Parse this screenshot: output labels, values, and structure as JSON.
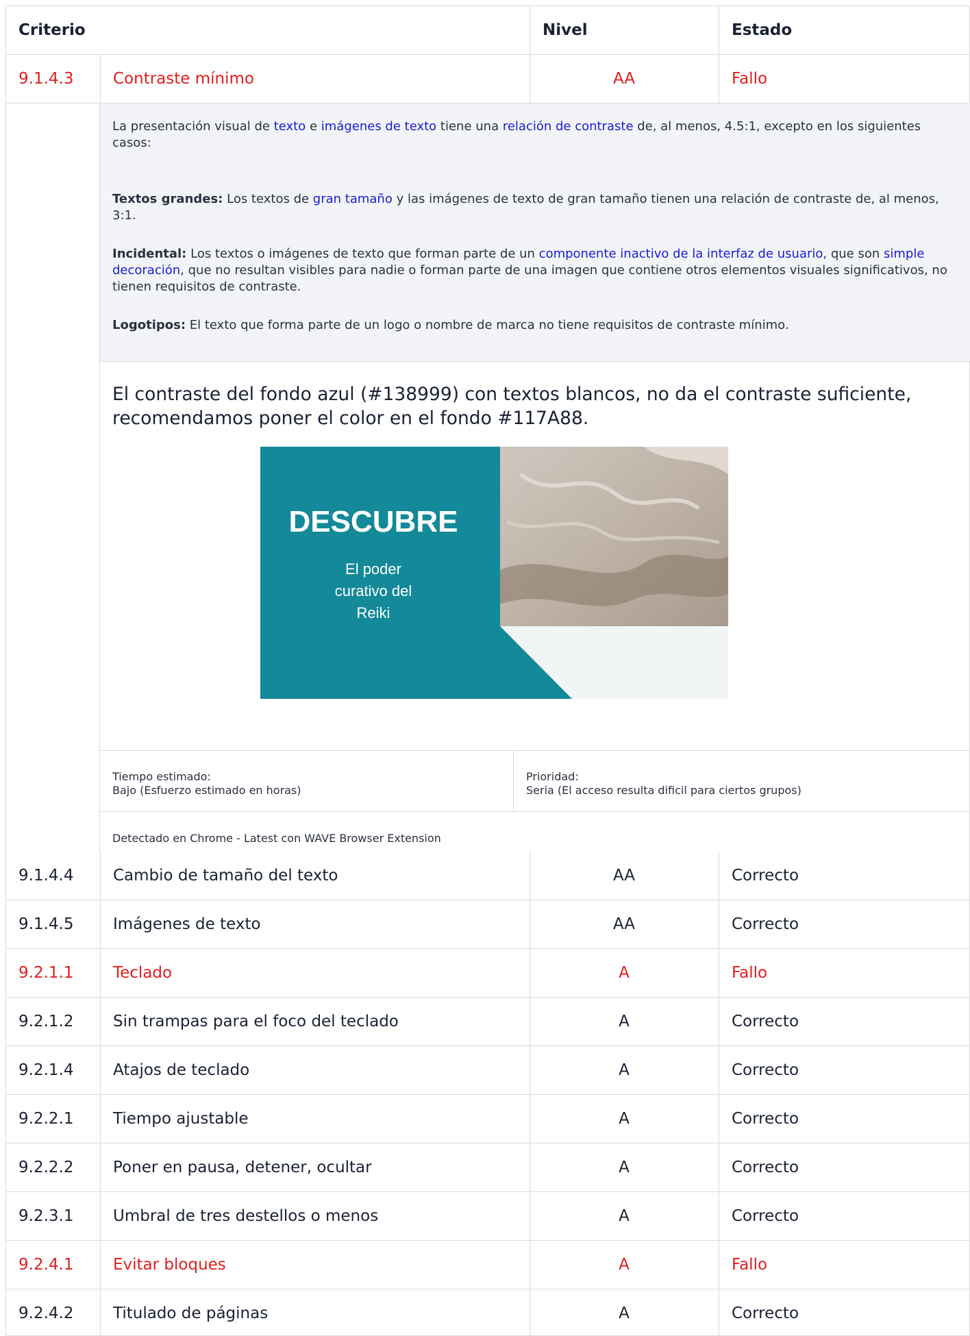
{
  "header": {
    "criterio": "Criterio",
    "nivel": "Nivel",
    "estado": "Estado"
  },
  "colors": {
    "fail": "#e11d1d",
    "link": "#1a1ad6",
    "banner_teal": "#138999",
    "suggested": "#117A88"
  },
  "detail": {
    "para1": [
      {
        "t": "La presentación visual de "
      },
      {
        "t": "texto",
        "link": true
      },
      {
        "t": " e "
      },
      {
        "t": "imágenes de texto",
        "link": true
      },
      {
        "t": " tiene una "
      },
      {
        "t": "relación de contraste",
        "link": true
      },
      {
        "t": " de, al menos, 4.5:1, excepto en los siguientes casos:"
      }
    ],
    "para2": [
      {
        "t": "Textos grandes:",
        "bold": true
      },
      {
        "t": " Los textos de "
      },
      {
        "t": "gran tamaño",
        "link": true
      },
      {
        "t": " y las imágenes de texto de gran tamaño tienen una relación de contraste de, al menos, 3:1."
      }
    ],
    "para3": [
      {
        "t": "Incidental:",
        "bold": true
      },
      {
        "t": " Los textos o imágenes de texto que forman parte de un "
      },
      {
        "t": "componente inactivo de la interfaz de usuario",
        "link": true
      },
      {
        "t": ", que son "
      },
      {
        "t": "simple decoración",
        "link": true
      },
      {
        "t": ", que no resultan visibles para nadie o forman parte de una imagen que contiene otros elementos visuales significativos, no tienen requisitos de contraste."
      }
    ],
    "para4": [
      {
        "t": "Logotipos:",
        "bold": true
      },
      {
        "t": " El texto que forma parte de un logo o nombre de marca no tiene requisitos de contraste mínimo."
      }
    ],
    "observation": "El contraste del fondo azul (#138999) con textos blancos, no da el contraste suficiente, recomendamos poner el color en el fondo #117A88.",
    "banner": {
      "headline": "DESCUBRE",
      "line1": "El poder",
      "line2": "curativo del",
      "line3": "Reiki"
    },
    "tiempo_label": "Tiempo estimado:",
    "tiempo_value": "Bajo (Esfuerzo estimado en horas)",
    "prioridad_label": "Prioridad:",
    "prioridad_value": "Seria (El acceso resulta dificil para ciertos grupos)",
    "detected": "Detectado en Chrome - Latest con WAVE Browser Extension"
  },
  "rows": [
    {
      "id": "9.1.4.3",
      "name": "Contraste mínimo",
      "level": "AA",
      "status": "Fallo"
    },
    {
      "id": "9.1.4.4",
      "name": "Cambio de tamaño del texto",
      "level": "AA",
      "status": "Correcto"
    },
    {
      "id": "9.1.4.5",
      "name": "Imágenes de texto",
      "level": "AA",
      "status": "Correcto"
    },
    {
      "id": "9.2.1.1",
      "name": "Teclado",
      "level": "A",
      "status": "Fallo"
    },
    {
      "id": "9.2.1.2",
      "name": "Sin trampas para el foco del teclado",
      "level": "A",
      "status": "Correcto"
    },
    {
      "id": "9.2.1.4",
      "name": "Atajos de teclado",
      "level": "A",
      "status": "Correcto"
    },
    {
      "id": "9.2.2.1",
      "name": "Tiempo ajustable",
      "level": "A",
      "status": "Correcto"
    },
    {
      "id": "9.2.2.2",
      "name": "Poner en pausa, detener, ocultar",
      "level": "A",
      "status": "Correcto"
    },
    {
      "id": "9.2.3.1",
      "name": "Umbral de tres destellos o menos",
      "level": "A",
      "status": "Correcto"
    },
    {
      "id": "9.2.4.1",
      "name": "Evitar bloques",
      "level": "A",
      "status": "Fallo"
    },
    {
      "id": "9.2.4.2",
      "name": "Titulado de páginas",
      "level": "A",
      "status": "Correcto"
    }
  ]
}
